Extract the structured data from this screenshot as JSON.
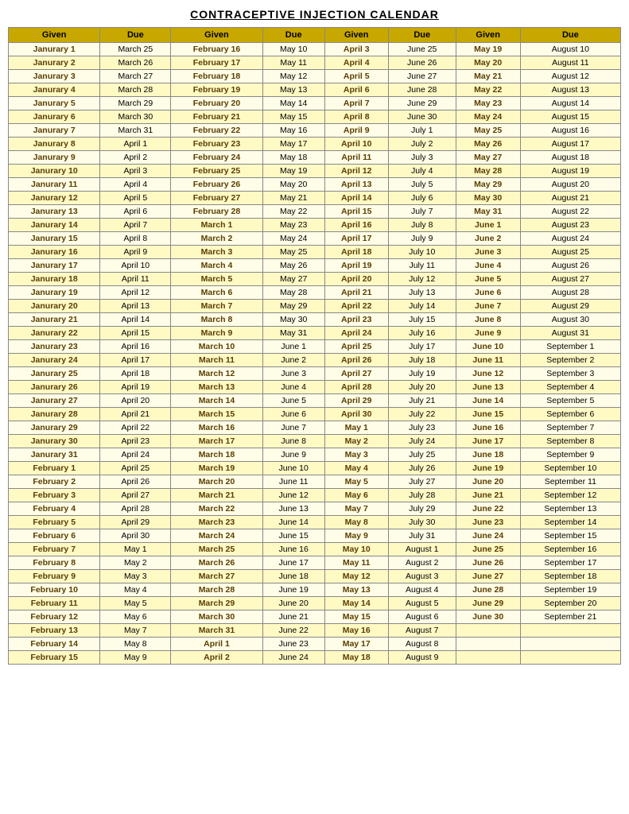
{
  "title": "CONTRACEPTIVE INJECTION CALENDAR",
  "headers": [
    "Given",
    "Due",
    "Given",
    "Due",
    "Given",
    "Due",
    "Given",
    "Due"
  ],
  "rows": [
    [
      "Janurary 1",
      "March 25",
      "February 16",
      "May 10",
      "April 3",
      "June 25",
      "May 19",
      "August 10"
    ],
    [
      "Janurary 2",
      "March 26",
      "February 17",
      "May 11",
      "April 4",
      "June 26",
      "May 20",
      "August 11"
    ],
    [
      "Janurary 3",
      "March 27",
      "February 18",
      "May 12",
      "April 5",
      "June 27",
      "May 21",
      "August 12"
    ],
    [
      "Janurary 4",
      "March 28",
      "February 19",
      "May 13",
      "April 6",
      "June 28",
      "May 22",
      "August 13"
    ],
    [
      "Janurary 5",
      "March 29",
      "February 20",
      "May 14",
      "April 7",
      "June 29",
      "May 23",
      "August 14"
    ],
    [
      "Janurary 6",
      "March 30",
      "February 21",
      "May 15",
      "April 8",
      "June 30",
      "May 24",
      "August 15"
    ],
    [
      "Janurary 7",
      "March 31",
      "February 22",
      "May 16",
      "April 9",
      "July 1",
      "May 25",
      "August 16"
    ],
    [
      "Janurary 8",
      "April 1",
      "February 23",
      "May 17",
      "April 10",
      "July 2",
      "May 26",
      "August 17"
    ],
    [
      "Janurary 9",
      "April 2",
      "February 24",
      "May 18",
      "April 11",
      "July 3",
      "May 27",
      "August 18"
    ],
    [
      "Janurary 10",
      "April 3",
      "February 25",
      "May 19",
      "April 12",
      "July 4",
      "May 28",
      "August 19"
    ],
    [
      "Janurary 11",
      "April 4",
      "February 26",
      "May 20",
      "April 13",
      "July 5",
      "May 29",
      "August 20"
    ],
    [
      "Janurary 12",
      "April 5",
      "February 27",
      "May 21",
      "April 14",
      "July 6",
      "May 30",
      "August 21"
    ],
    [
      "Janurary 13",
      "April 6",
      "February 28",
      "May 22",
      "April 15",
      "July 7",
      "May 31",
      "August 22"
    ],
    [
      "Janurary 14",
      "April 7",
      "March 1",
      "May 23",
      "April 16",
      "July 8",
      "June 1",
      "August 23"
    ],
    [
      "Janurary 15",
      "April 8",
      "March 2",
      "May 24",
      "April 17",
      "July 9",
      "June 2",
      "August 24"
    ],
    [
      "Janurary 16",
      "April 9",
      "March 3",
      "May 25",
      "April 18",
      "July 10",
      "June 3",
      "August 25"
    ],
    [
      "Janurary 17",
      "April 10",
      "March 4",
      "May 26",
      "April 19",
      "July 11",
      "June 4",
      "August 26"
    ],
    [
      "Janurary 18",
      "April 11",
      "March 5",
      "May 27",
      "April 20",
      "July 12",
      "June 5",
      "August 27"
    ],
    [
      "Janurary 19",
      "April 12",
      "March 6",
      "May 28",
      "April 21",
      "July 13",
      "June 6",
      "August 28"
    ],
    [
      "Janurary 20",
      "April 13",
      "March 7",
      "May 29",
      "April 22",
      "July 14",
      "June 7",
      "August 29"
    ],
    [
      "Janurary 21",
      "April 14",
      "March 8",
      "May 30",
      "April 23",
      "July 15",
      "June 8",
      "August 30"
    ],
    [
      "Janurary 22",
      "April 15",
      "March 9",
      "May 31",
      "April 24",
      "July 16",
      "June 9",
      "August 31"
    ],
    [
      "Janurary 23",
      "April 16",
      "March 10",
      "June 1",
      "April 25",
      "July 17",
      "June 10",
      "September 1"
    ],
    [
      "Janurary 24",
      "April 17",
      "March 11",
      "June 2",
      "April 26",
      "July 18",
      "June 11",
      "September 2"
    ],
    [
      "Janurary 25",
      "April 18",
      "March 12",
      "June 3",
      "April 27",
      "July 19",
      "June 12",
      "September 3"
    ],
    [
      "Janurary 26",
      "April 19",
      "March 13",
      "June 4",
      "April 28",
      "July 20",
      "June 13",
      "September 4"
    ],
    [
      "Janurary 27",
      "April 20",
      "March 14",
      "June 5",
      "April 29",
      "July 21",
      "June 14",
      "September 5"
    ],
    [
      "Janurary 28",
      "April 21",
      "March 15",
      "June 6",
      "April 30",
      "July 22",
      "June 15",
      "September 6"
    ],
    [
      "Janurary 29",
      "April 22",
      "March 16",
      "June 7",
      "May 1",
      "July 23",
      "June 16",
      "September 7"
    ],
    [
      "Janurary 30",
      "April 23",
      "March 17",
      "June 8",
      "May 2",
      "July 24",
      "June 17",
      "September 8"
    ],
    [
      "Janurary 31",
      "April 24",
      "March 18",
      "June 9",
      "May 3",
      "July 25",
      "June 18",
      "September 9"
    ],
    [
      "February 1",
      "April 25",
      "March 19",
      "June 10",
      "May 4",
      "July 26",
      "June 19",
      "September 10"
    ],
    [
      "February 2",
      "April 26",
      "March 20",
      "June 11",
      "May 5",
      "July 27",
      "June 20",
      "September 11"
    ],
    [
      "February 3",
      "April 27",
      "March 21",
      "June 12",
      "May 6",
      "July 28",
      "June 21",
      "September 12"
    ],
    [
      "February 4",
      "April 28",
      "March 22",
      "June 13",
      "May 7",
      "July 29",
      "June 22",
      "September 13"
    ],
    [
      "February 5",
      "April 29",
      "March 23",
      "June 14",
      "May 8",
      "July 30",
      "June 23",
      "September 14"
    ],
    [
      "February 6",
      "April 30",
      "March 24",
      "June 15",
      "May 9",
      "July 31",
      "June 24",
      "September 15"
    ],
    [
      "February 7",
      "May 1",
      "March 25",
      "June 16",
      "May 10",
      "August 1",
      "June 25",
      "September 16"
    ],
    [
      "February 8",
      "May 2",
      "March 26",
      "June 17",
      "May 11",
      "August 2",
      "June 26",
      "September 17"
    ],
    [
      "February 9",
      "May 3",
      "March 27",
      "June 18",
      "May 12",
      "August 3",
      "June 27",
      "September 18"
    ],
    [
      "February 10",
      "May 4",
      "March 28",
      "June 19",
      "May 13",
      "August 4",
      "June 28",
      "September 19"
    ],
    [
      "February 11",
      "May 5",
      "March 29",
      "June 20",
      "May 14",
      "August 5",
      "June 29",
      "September 20"
    ],
    [
      "February 12",
      "May 6",
      "March 30",
      "June 21",
      "May 15",
      "August 6",
      "June 30",
      "September 21"
    ],
    [
      "February 13",
      "May 7",
      "March 31",
      "June 22",
      "May 16",
      "August 7",
      "",
      ""
    ],
    [
      "February 14",
      "May 8",
      "April 1",
      "June 23",
      "May 17",
      "August 8",
      "",
      ""
    ],
    [
      "February 15",
      "May 9",
      "April 2",
      "June 24",
      "May 18",
      "August 9",
      "",
      ""
    ]
  ]
}
